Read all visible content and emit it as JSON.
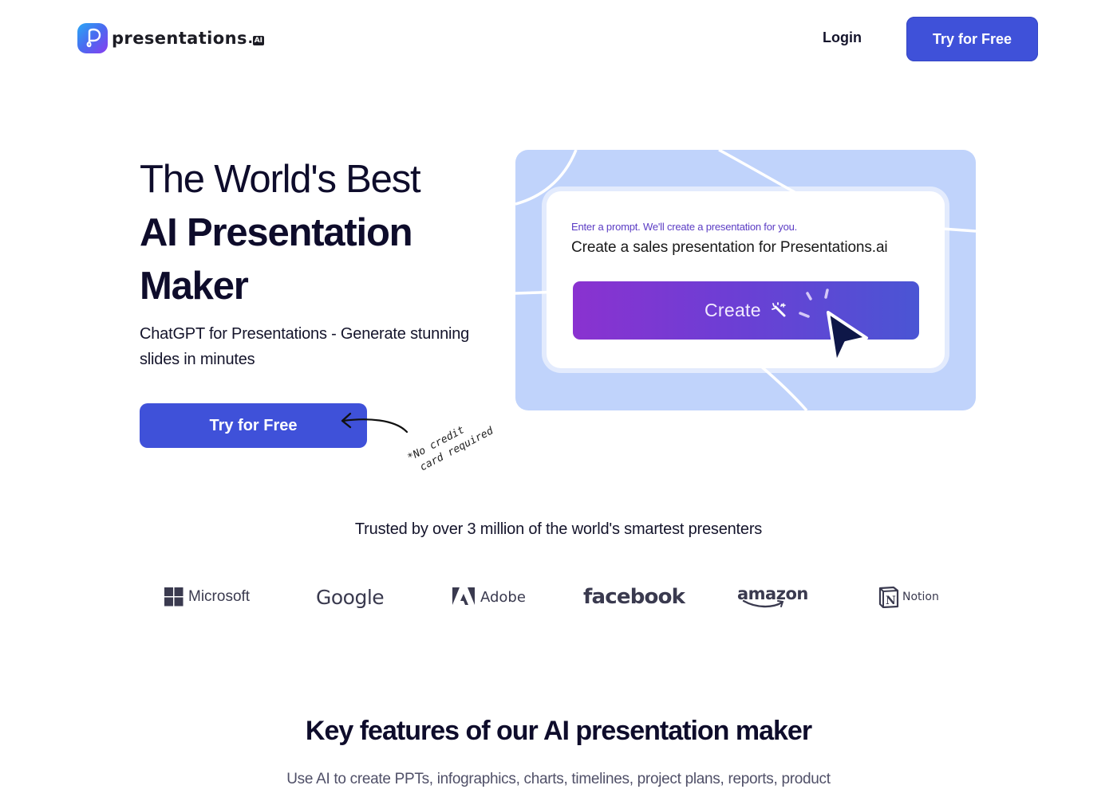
{
  "header": {
    "logo_text": "presentations",
    "logo_dot": ".",
    "logo_badge": "AI",
    "login_label": "Login",
    "cta_label": "Try for Free"
  },
  "hero": {
    "title_line1": "The World's Best",
    "title_line2": "AI Presentation",
    "title_line3": "Maker",
    "subtitle": "ChatGPT for Presentations - Generate stunning slides in minutes",
    "cta_label": "Try for Free",
    "note_line1": "*No credit",
    "note_line2": "card required"
  },
  "illustration": {
    "prompt_label": "Enter a prompt. We'll create a presentation for you.",
    "prompt_value": "Create a sales presentation for Presentations.ai",
    "create_label": "Create",
    "icons": [
      "magic-wand-icon",
      "click-spark-icon",
      "mouse-cursor-icon"
    ]
  },
  "trusted": {
    "text": "Trusted by over 3 million of the world's smartest presenters",
    "brands": [
      {
        "name": "Microsoft",
        "icon": "microsoft-logo-icon"
      },
      {
        "name": "Google",
        "icon": "google-logo"
      },
      {
        "name": "Adobe",
        "icon": "adobe-logo-icon"
      },
      {
        "name": "facebook",
        "icon": "facebook-logo"
      },
      {
        "name": "amazon",
        "icon": "amazon-smile-icon"
      },
      {
        "name": "Notion",
        "icon": "notion-logo-icon"
      }
    ]
  },
  "features": {
    "title_light": "Key features of our ",
    "title_bold": "AI presentation maker",
    "subtitle": "Use AI to create PPTs, infographics, charts, timelines, project plans, reports, product"
  },
  "colors": {
    "primary": "#3f51d9",
    "illustration_bg": "#c0d3fb",
    "create_gradient_start": "#8a32d0",
    "create_gradient_end": "#4a55d4",
    "heading": "#0e0c2b"
  }
}
